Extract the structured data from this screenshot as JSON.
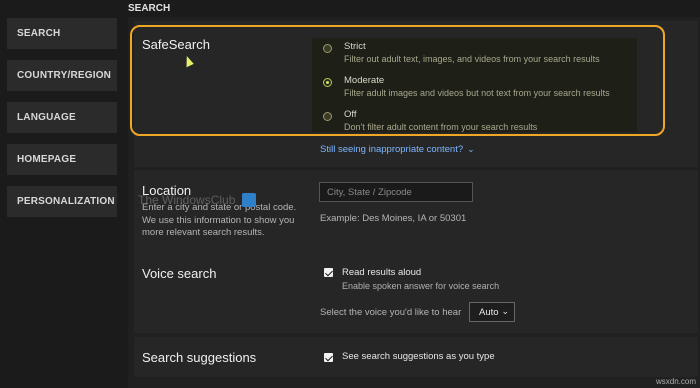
{
  "sidebar": {
    "items": [
      {
        "label": "SEARCH"
      },
      {
        "label": "COUNTRY/REGION"
      },
      {
        "label": "LANGUAGE"
      },
      {
        "label": "HOMEPAGE"
      },
      {
        "label": "PERSONALIZATION"
      }
    ]
  },
  "header": {
    "section": "SEARCH"
  },
  "safesearch": {
    "title": "SafeSearch",
    "options": [
      {
        "label": "Strict",
        "description": "Filter out adult text, images, and videos from your search results",
        "selected": false
      },
      {
        "label": "Moderate",
        "description": "Filter adult images and videos but not text from your search results",
        "selected": true
      },
      {
        "label": "Off",
        "description": "Don't filter adult content from your search results",
        "selected": false
      }
    ],
    "help_link": "Still seeing inappropriate content?"
  },
  "location": {
    "title": "Location",
    "description": "Enter a city and state or postal code. We use this information to show you more relevant search results.",
    "placeholder": "City, State / Zipcode",
    "example": "Example: Des Moines, IA or 50301"
  },
  "voice_search": {
    "title": "Voice search",
    "checkbox_label": "Read results aloud",
    "checkbox_sub": "Enable spoken answer for voice search",
    "checked": true,
    "voice_prompt": "Select the voice you'd like to hear",
    "voice_value": "Auto"
  },
  "search_suggestions": {
    "title": "Search suggestions",
    "checkbox_label": "See search suggestions as you type",
    "checked": true
  },
  "watermark": {
    "text": "The WindowsClub"
  },
  "footer": {
    "text": "wsxdn.com"
  },
  "colors": {
    "highlight": "#f0a726",
    "link": "#7fb6ff",
    "accent": "#cfe06a"
  }
}
